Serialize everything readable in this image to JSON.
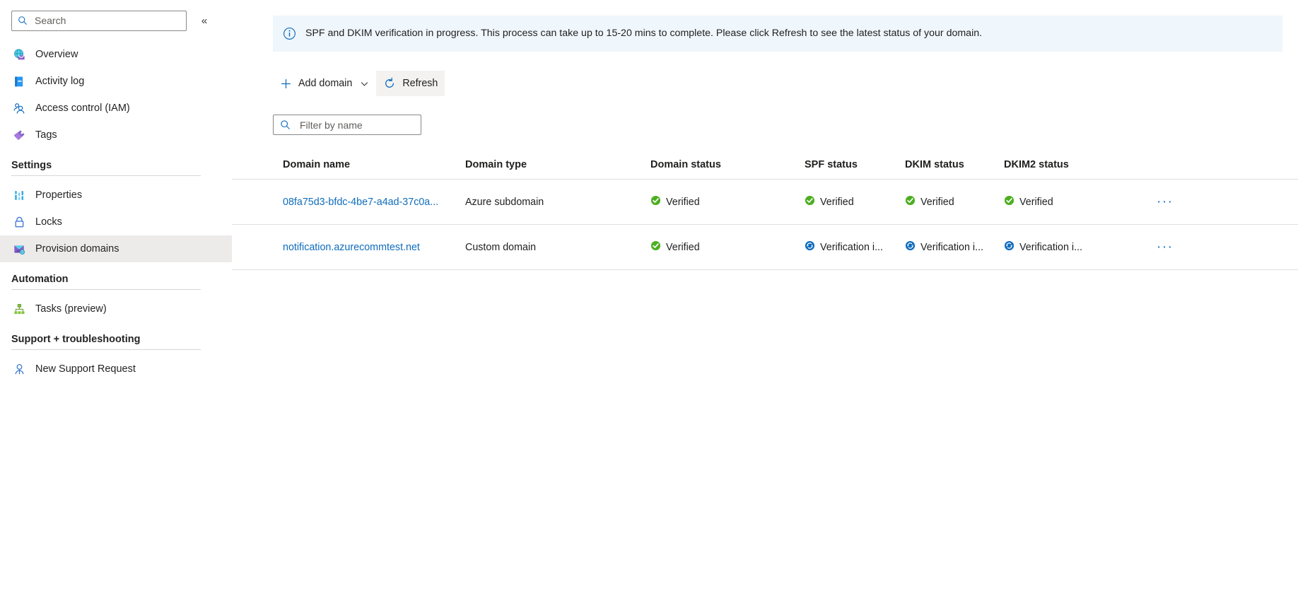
{
  "sidebar": {
    "search": {
      "placeholder": "Search",
      "value": "",
      "icon": "search-icon"
    },
    "collapse": {
      "label": "«",
      "icon": "collapse-chevrons-icon"
    },
    "items": [
      {
        "label": "Overview",
        "icon": "email-globe-icon",
        "selected": false
      },
      {
        "label": "Activity log",
        "icon": "activity-log-icon",
        "selected": false
      },
      {
        "label": "Access control (IAM)",
        "icon": "people-icon",
        "selected": false
      },
      {
        "label": "Tags",
        "icon": "tag-icon",
        "selected": false
      }
    ],
    "groups": [
      {
        "title": "Settings",
        "items": [
          {
            "label": "Properties",
            "icon": "properties-icon",
            "selected": false
          },
          {
            "label": "Locks",
            "icon": "lock-icon",
            "selected": false
          },
          {
            "label": "Provision domains",
            "icon": "provision-domains-icon",
            "selected": true
          }
        ]
      },
      {
        "title": "Automation",
        "items": [
          {
            "label": "Tasks (preview)",
            "icon": "tasks-icon",
            "selected": false
          }
        ]
      },
      {
        "title": "Support + troubleshooting",
        "items": [
          {
            "label": "New Support Request",
            "icon": "support-person-icon",
            "selected": false
          }
        ]
      }
    ]
  },
  "banner": {
    "icon": "info-circle-icon",
    "text": "SPF and DKIM verification in progress. This process can take up to 15-20 mins to complete. Please click Refresh to see the latest status of your domain.",
    "background": "#eff6fc"
  },
  "toolbar": {
    "add_domain_label": "Add domain",
    "add_domain_icon": "plus-icon",
    "add_domain_caret_icon": "chevron-down-icon",
    "refresh_label": "Refresh",
    "refresh_icon": "refresh-circle-icon"
  },
  "filter": {
    "placeholder": "Filter by name",
    "value": "",
    "icon": "search-icon"
  },
  "table": {
    "columns": [
      "Domain name",
      "Domain type",
      "Domain status",
      "SPF status",
      "DKIM status",
      "DKIM2 status"
    ],
    "rows": [
      {
        "name": "08fa75d3-bfdc-4be7-a4ad-37c0a...",
        "type": "Azure subdomain",
        "domain_status": {
          "text": "Verified",
          "state": "verified"
        },
        "spf_status": {
          "text": "Verified",
          "state": "verified"
        },
        "dkim_status": {
          "text": "Verified",
          "state": "verified"
        },
        "dkim2_status": {
          "text": "Verified",
          "state": "verified"
        },
        "more_label": "···"
      },
      {
        "name": "notification.azurecommtest.net",
        "type": "Custom domain",
        "domain_status": {
          "text": "Verified",
          "state": "verified"
        },
        "spf_status": {
          "text": "Verification i...",
          "state": "in-progress"
        },
        "dkim_status": {
          "text": "Verification i...",
          "state": "in-progress"
        },
        "dkim2_status": {
          "text": "Verification i...",
          "state": "in-progress"
        },
        "more_label": "···"
      }
    ]
  },
  "colors": {
    "link": "#0f6cbd",
    "verified_green": "#4caf21",
    "in_progress_blue": "#0f6cbd",
    "selected_row": "#edebe9",
    "banner_bg": "#eff6fc"
  }
}
